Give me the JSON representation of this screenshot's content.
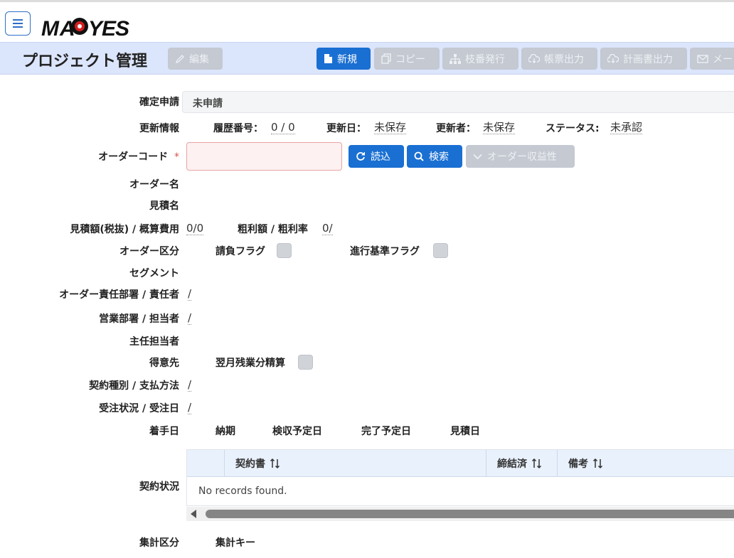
{
  "app": {
    "logo_text": "MAEYES"
  },
  "header": {
    "title": "プロジェクト管理",
    "edit_label": "編集",
    "toolbar": [
      {
        "label": "新規",
        "icon": "file-icon",
        "state": "primary"
      },
      {
        "label": "コピー",
        "icon": "copy-icon",
        "state": "disabled"
      },
      {
        "label": "枝番発行",
        "icon": "sitemap-icon",
        "state": "disabled"
      },
      {
        "label": "帳票出力",
        "icon": "cloud-download-icon",
        "state": "disabled"
      },
      {
        "label": "計画書出力",
        "icon": "cloud-download-icon",
        "state": "disabled"
      },
      {
        "label": "メー",
        "icon": "envelope-icon",
        "state": "disabled"
      }
    ]
  },
  "form": {
    "kakutei": {
      "label": "確定申請",
      "value": "未申請"
    },
    "koushin": {
      "label": "更新情報",
      "rireki_label": "履歴番号：",
      "rireki_value": "0 / 0",
      "date_label": "更新日：",
      "date_value": "未保存",
      "user_label": "更新者：",
      "user_value": "未保存",
      "status_label": "ステータス:",
      "status_value": "未承認"
    },
    "order_code": {
      "label": "オーダーコード",
      "required_mark": "*",
      "value": "",
      "read_label": "読込",
      "search_label": "検索",
      "profit_label": "オーダー収益性"
    },
    "order_name": {
      "label": "オーダー名"
    },
    "mitsumori_name": {
      "label": "見積名"
    },
    "amount": {
      "label": "見積額(税抜) / 概算費用",
      "value": "0/0",
      "profit_label": "粗利額 / 粗利率",
      "profit_value": "0/"
    },
    "order_kubun": {
      "label": "オーダー区分",
      "ukeoi_label": "請負フラグ",
      "ukeoi_checked": false,
      "shinko_label": "進行基準フラグ",
      "shinko_checked": false
    },
    "segment": {
      "label": "セグメント"
    },
    "sekinin": {
      "label": "オーダー責任部署 / 責任者",
      "value": "/"
    },
    "eigyo": {
      "label": "営業部署 / 担当者",
      "value": "/"
    },
    "shunin": {
      "label": "主任担当者"
    },
    "tokuisaki": {
      "label": "得意先",
      "zangyo_label": "翌月残業分精算",
      "zangyo_checked": false
    },
    "keiyaku": {
      "label": "契約種別 / 支払方法",
      "value": "/"
    },
    "juchu": {
      "label": "受注状況 / 受注日",
      "value": "/"
    },
    "dates": {
      "chakushu_label": "着手日",
      "nouki_label": "納期",
      "kenshu_label": "検収予定日",
      "kanryo_label": "完了予定日",
      "mitsumori_label": "見積日"
    },
    "keiyaku_jokyo": {
      "label": "契約状況",
      "columns": [
        "契約書",
        "締結済",
        "備考"
      ],
      "empty_text": "No records found."
    },
    "shukei": {
      "label": "集計区分",
      "key_label": "集計キー"
    }
  },
  "colors": {
    "primary": "#1a6fd2",
    "header_bg": "#dbe5fb",
    "disabled": "#c4c9d2",
    "required": "#d9534f"
  }
}
